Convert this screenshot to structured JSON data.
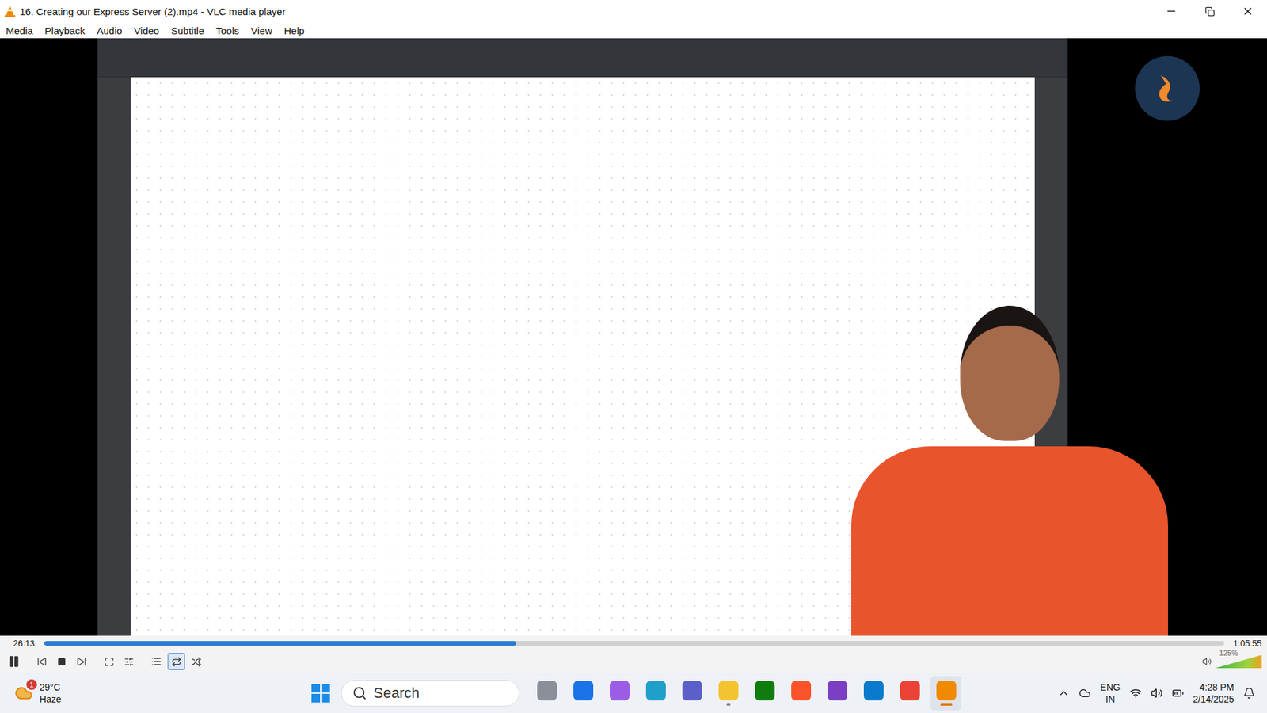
{
  "window": {
    "title": "16. Creating our Express Server (2).mp4 - VLC media player"
  },
  "menu": [
    "Media",
    "Playback",
    "Audio",
    "Video",
    "Subtitle",
    "Tools",
    "View",
    "Help"
  ],
  "player": {
    "elapsed": "26:13",
    "duration": "1:05:55",
    "level": 0.4,
    "playing": true,
    "loop": true,
    "volume": {
      "reading": "125%",
      "level": 1.0
    }
  },
  "taskbar": {
    "weather": {
      "temp": "29°C",
      "condition": "Haze",
      "badge": "1"
    },
    "search": {
      "placeholder": "Search"
    },
    "apps": [
      {
        "color": "#8a8f99",
        "running": false,
        "active": false
      },
      {
        "color": "#1a73e8",
        "running": false,
        "active": false
      },
      {
        "color": "#9b5de5",
        "running": false,
        "active": false
      },
      {
        "color": "#1fa0c9",
        "running": false,
        "active": false
      },
      {
        "color": "#5b5fc7",
        "running": false,
        "active": false
      },
      {
        "color": "#f4c430",
        "running": true,
        "active": false
      },
      {
        "color": "#107c10",
        "running": false,
        "active": false
      },
      {
        "color": "#fb542b",
        "running": false,
        "active": false
      },
      {
        "color": "#7a3fc2",
        "running": false,
        "active": false
      },
      {
        "color": "#0a7acc",
        "running": false,
        "active": false
      },
      {
        "color": "#ea4335",
        "running": false,
        "active": false
      },
      {
        "color": "#f08a00",
        "running": true,
        "active": true
      }
    ],
    "tray": {
      "language": "ENG",
      "region": "IN",
      "time": "4:28 PM",
      "date": "2/14/2025"
    }
  }
}
